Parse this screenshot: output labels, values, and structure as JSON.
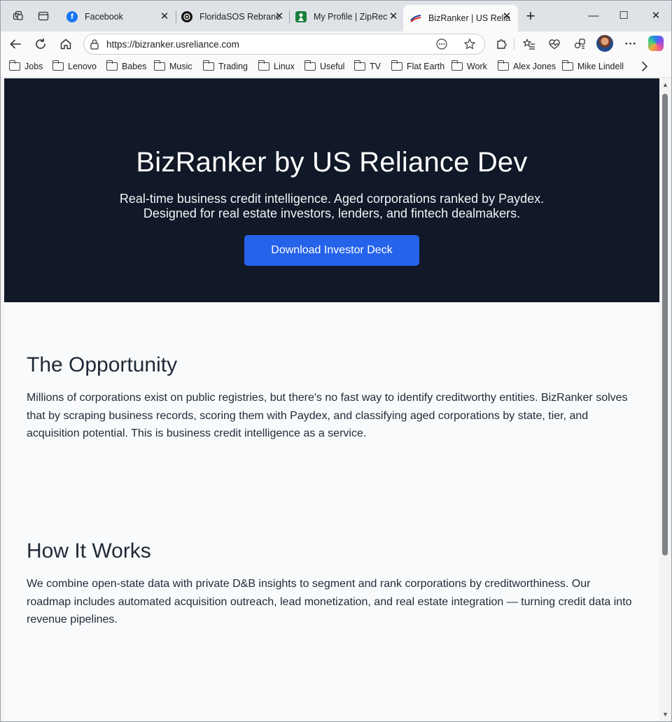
{
  "browser": {
    "tabs": [
      {
        "title": "Facebook",
        "favicon": "facebook-icon",
        "color": "#1877f2",
        "active": false
      },
      {
        "title": "FloridaSOS Rebranc",
        "favicon": "openai-icon",
        "color": "#111111",
        "active": false
      },
      {
        "title": "My Profile | ZipRec",
        "favicon": "ziprecruiter-icon",
        "color": "#1a7f3c",
        "active": false
      },
      {
        "title": "BizRanker | US Relia",
        "favicon": "us-flag-icon",
        "color": "#c0392b",
        "active": true
      }
    ],
    "address": {
      "url": "https://bizranker.usreliance.com"
    },
    "bookmarks": [
      "Jobs",
      "Lenovo",
      "Babes",
      "Music",
      "Trading",
      "Linux",
      "Useful",
      "TV",
      "Flat Earth",
      "Work",
      "Alex Jones",
      "Mike Lindell"
    ]
  },
  "page": {
    "hero": {
      "title": "BizRanker by US Reliance Dev",
      "subtitle_line1": "Real-time business credit intelligence. Aged corporations ranked by Paydex.",
      "subtitle_line2": "Designed for real estate investors, lenders, and fintech dealmakers.",
      "cta_label": "Download Investor Deck"
    },
    "sections": [
      {
        "title": "The Opportunity",
        "body": "Millions of corporations exist on public registries, but there's no fast way to identify creditworthy entities. BizRanker solves that by scraping business records, scoring them with Paydex, and classifying aged corporations by state, tier, and acquisition potential. This is business credit intelligence as a service."
      },
      {
        "title": "How It Works",
        "body": "We combine open-state data with private D&B insights to segment and rank corporations by creditworthiness. Our roadmap includes automated acquisition outreach, lead monetization, and real estate integration — turning credit data into revenue pipelines."
      }
    ]
  },
  "colors": {
    "hero_bg": "#111827",
    "cta_bg": "#2563eb",
    "page_bg": "#f9fafb",
    "heading": "#1f2937"
  }
}
